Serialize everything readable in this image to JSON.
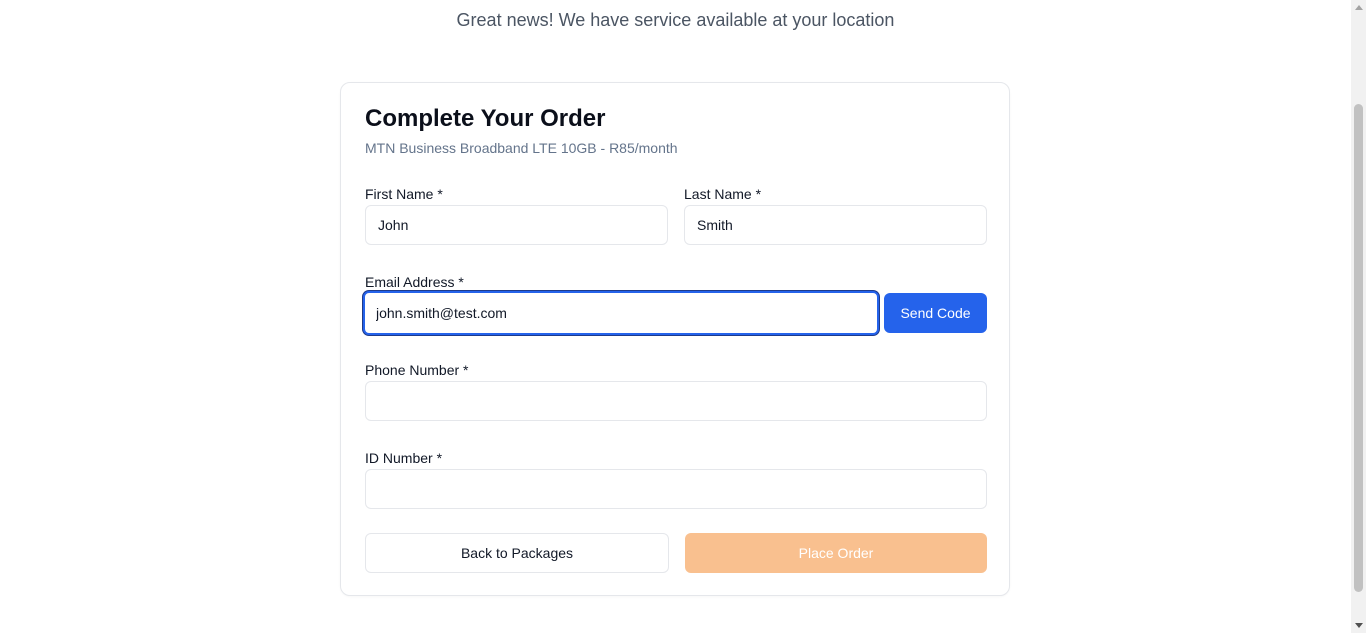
{
  "banner": {
    "text": "Great news! We have service available at your location"
  },
  "order": {
    "title": "Complete Your Order",
    "package": "MTN Business Broadband LTE 10GB - R85/month",
    "first_name": {
      "label": "First Name *",
      "value": "John"
    },
    "last_name": {
      "label": "Last Name *",
      "value": "Smith"
    },
    "email": {
      "label": "Email Address *",
      "value": "john.smith@test.com"
    },
    "send_code_label": "Send Code",
    "phone": {
      "label": "Phone Number *",
      "value": ""
    },
    "id_number": {
      "label": "ID Number *",
      "value": ""
    },
    "back_label": "Back to Packages",
    "place_order_label": "Place Order"
  },
  "colors": {
    "primary": "#2563eb",
    "place_order_disabled": "#f9c08f",
    "muted_text": "#64748b",
    "border": "#e5e7eb"
  }
}
